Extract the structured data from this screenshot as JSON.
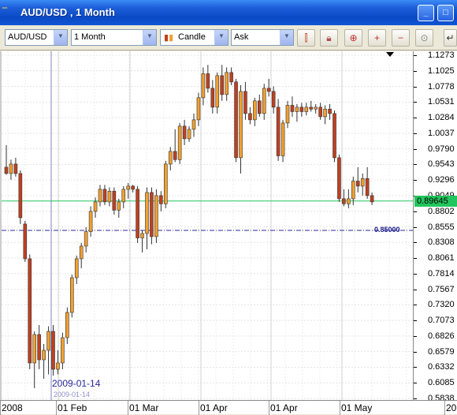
{
  "window": {
    "title": "AUD/USD , 1 Month",
    "accent": "#0a49c6"
  },
  "toolbar": {
    "symbol": "AUD/USD",
    "period": "1 Month",
    "chart_type": "Candle",
    "price_side": "Ask",
    "icons": [
      "bar-chart-icon",
      "lock-icon",
      "zoom-icon",
      "zoom-in-icon",
      "zoom-out-icon",
      "zoom-fit-icon",
      "back-icon"
    ]
  },
  "chart": {
    "price_labels": [
      "1.1273",
      "1.1025",
      "1.0778",
      "1.0531",
      "1.0284",
      "1.0037",
      "0.9790",
      "0.9543",
      "0.9296",
      "0.9049",
      "0.8802",
      "0.8555",
      "0.8308",
      "0.8061",
      "0.7814",
      "0.7567",
      "0.7320",
      "0.7073",
      "0.6826",
      "0.6579",
      "0.6332",
      "0.6085",
      "0.5838"
    ],
    "time_labels": [
      "2008",
      "01 Feb",
      "01 Mar",
      "01 Apr",
      "01 Apr",
      "01 May",
      "20"
    ],
    "current_price": "0.89645",
    "current_price_color": "#22c55e",
    "level_line": "0.85000",
    "level_color": "#1a1a8a",
    "cursor_date": "2009-01-14",
    "cursor_date_small": "2009-01-14",
    "bull_color": "#f0a030",
    "bear_color": "#c04020"
  },
  "chart_data": {
    "type": "candlestick",
    "ylim": [
      0.5838,
      1.1273
    ],
    "candles": [
      {
        "o": 0.95,
        "h": 0.985,
        "l": 0.938,
        "c": 0.94
      },
      {
        "o": 0.94,
        "h": 0.962,
        "l": 0.93,
        "c": 0.955
      },
      {
        "o": 0.955,
        "h": 0.965,
        "l": 0.935,
        "c": 0.94
      },
      {
        "o": 0.94,
        "h": 0.945,
        "l": 0.86,
        "c": 0.87
      },
      {
        "o": 0.86,
        "h": 0.865,
        "l": 0.8,
        "c": 0.805
      },
      {
        "o": 0.805,
        "h": 0.812,
        "l": 0.63,
        "c": 0.64
      },
      {
        "o": 0.64,
        "h": 0.69,
        "l": 0.6,
        "c": 0.685
      },
      {
        "o": 0.685,
        "h": 0.7,
        "l": 0.63,
        "c": 0.645
      },
      {
        "o": 0.645,
        "h": 0.67,
        "l": 0.615,
        "c": 0.66
      },
      {
        "o": 0.66,
        "h": 0.698,
        "l": 0.622,
        "c": 0.69
      },
      {
        "o": 0.69,
        "h": 0.7,
        "l": 0.62,
        "c": 0.63
      },
      {
        "o": 0.63,
        "h": 0.66,
        "l": 0.622,
        "c": 0.64
      },
      {
        "o": 0.64,
        "h": 0.688,
        "l": 0.63,
        "c": 0.68
      },
      {
        "o": 0.68,
        "h": 0.728,
        "l": 0.67,
        "c": 0.72
      },
      {
        "o": 0.72,
        "h": 0.78,
        "l": 0.712,
        "c": 0.775
      },
      {
        "o": 0.775,
        "h": 0.81,
        "l": 0.765,
        "c": 0.805
      },
      {
        "o": 0.805,
        "h": 0.83,
        "l": 0.79,
        "c": 0.825
      },
      {
        "o": 0.825,
        "h": 0.855,
        "l": 0.815,
        "c": 0.848
      },
      {
        "o": 0.848,
        "h": 0.888,
        "l": 0.84,
        "c": 0.88
      },
      {
        "o": 0.88,
        "h": 0.902,
        "l": 0.87,
        "c": 0.895
      },
      {
        "o": 0.895,
        "h": 0.922,
        "l": 0.888,
        "c": 0.915
      },
      {
        "o": 0.915,
        "h": 0.922,
        "l": 0.89,
        "c": 0.895
      },
      {
        "o": 0.895,
        "h": 0.918,
        "l": 0.888,
        "c": 0.912
      },
      {
        "o": 0.912,
        "h": 0.918,
        "l": 0.875,
        "c": 0.882
      },
      {
        "o": 0.882,
        "h": 0.9,
        "l": 0.87,
        "c": 0.895
      },
      {
        "o": 0.895,
        "h": 0.92,
        "l": 0.885,
        "c": 0.915
      },
      {
        "o": 0.915,
        "h": 0.925,
        "l": 0.9,
        "c": 0.92
      },
      {
        "o": 0.92,
        "h": 0.922,
        "l": 0.91,
        "c": 0.915
      },
      {
        "o": 0.915,
        "h": 0.92,
        "l": 0.83,
        "c": 0.838
      },
      {
        "o": 0.838,
        "h": 0.85,
        "l": 0.815,
        "c": 0.845
      },
      {
        "o": 0.845,
        "h": 0.918,
        "l": 0.82,
        "c": 0.91
      },
      {
        "o": 0.91,
        "h": 0.918,
        "l": 0.828,
        "c": 0.84
      },
      {
        "o": 0.84,
        "h": 0.915,
        "l": 0.83,
        "c": 0.905
      },
      {
        "o": 0.905,
        "h": 0.912,
        "l": 0.88,
        "c": 0.892
      },
      {
        "o": 0.892,
        "h": 0.96,
        "l": 0.885,
        "c": 0.955
      },
      {
        "o": 0.955,
        "h": 0.982,
        "l": 0.945,
        "c": 0.975
      },
      {
        "o": 0.975,
        "h": 1.01,
        "l": 0.958,
        "c": 0.962
      },
      {
        "o": 0.962,
        "h": 1.02,
        "l": 0.955,
        "c": 1.015
      },
      {
        "o": 1.015,
        "h": 1.025,
        "l": 0.985,
        "c": 0.995
      },
      {
        "o": 0.995,
        "h": 1.015,
        "l": 0.99,
        "c": 1.01
      },
      {
        "o": 1.01,
        "h": 1.035,
        "l": 0.998,
        "c": 1.025
      },
      {
        "o": 1.025,
        "h": 1.068,
        "l": 1.015,
        "c": 1.06
      },
      {
        "o": 1.06,
        "h": 1.108,
        "l": 1.048,
        "c": 1.098
      },
      {
        "o": 1.098,
        "h": 1.112,
        "l": 1.068,
        "c": 1.075
      },
      {
        "o": 1.075,
        "h": 1.088,
        "l": 1.035,
        "c": 1.045
      },
      {
        "o": 1.045,
        "h": 1.1,
        "l": 1.035,
        "c": 1.095
      },
      {
        "o": 1.095,
        "h": 1.112,
        "l": 1.055,
        "c": 1.065
      },
      {
        "o": 1.065,
        "h": 1.108,
        "l": 1.055,
        "c": 1.1
      },
      {
        "o": 1.1,
        "h": 1.108,
        "l": 1.08,
        "c": 1.085
      },
      {
        "o": 1.085,
        "h": 1.09,
        "l": 0.958,
        "c": 0.965
      },
      {
        "o": 0.965,
        "h": 1.08,
        "l": 0.94,
        "c": 1.07
      },
      {
        "o": 1.07,
        "h": 1.085,
        "l": 1.025,
        "c": 1.035
      },
      {
        "o": 1.035,
        "h": 1.045,
        "l": 1.018,
        "c": 1.025
      },
      {
        "o": 1.025,
        "h": 1.06,
        "l": 1.015,
        "c": 1.055
      },
      {
        "o": 1.055,
        "h": 1.065,
        "l": 1.03,
        "c": 1.035
      },
      {
        "o": 1.035,
        "h": 1.082,
        "l": 1.025,
        "c": 1.075
      },
      {
        "o": 1.075,
        "h": 1.09,
        "l": 1.062,
        "c": 1.07
      },
      {
        "o": 1.07,
        "h": 1.078,
        "l": 1.035,
        "c": 1.045
      },
      {
        "o": 1.045,
        "h": 1.058,
        "l": 0.96,
        "c": 0.968
      },
      {
        "o": 0.968,
        "h": 1.025,
        "l": 0.958,
        "c": 1.02
      },
      {
        "o": 1.02,
        "h": 1.055,
        "l": 1.012,
        "c": 1.048
      },
      {
        "o": 1.048,
        "h": 1.062,
        "l": 1.03,
        "c": 1.038
      },
      {
        "o": 1.038,
        "h": 1.05,
        "l": 1.022,
        "c": 1.045
      },
      {
        "o": 1.045,
        "h": 1.052,
        "l": 1.03,
        "c": 1.038
      },
      {
        "o": 1.038,
        "h": 1.052,
        "l": 1.032,
        "c": 1.045
      },
      {
        "o": 1.045,
        "h": 1.055,
        "l": 1.038,
        "c": 1.042
      },
      {
        "o": 1.042,
        "h": 1.05,
        "l": 1.035,
        "c": 1.045
      },
      {
        "o": 1.045,
        "h": 1.052,
        "l": 1.025,
        "c": 1.03
      },
      {
        "o": 1.03,
        "h": 1.048,
        "l": 1.018,
        "c": 1.042
      },
      {
        "o": 1.042,
        "h": 1.05,
        "l": 1.025,
        "c": 1.035
      },
      {
        "o": 1.035,
        "h": 1.04,
        "l": 0.958,
        "c": 0.965
      },
      {
        "o": 0.965,
        "h": 0.97,
        "l": 0.895,
        "c": 0.9
      },
      {
        "o": 0.9,
        "h": 0.915,
        "l": 0.888,
        "c": 0.892
      },
      {
        "o": 0.892,
        "h": 0.915,
        "l": 0.885,
        "c": 0.9
      },
      {
        "o": 0.9,
        "h": 0.935,
        "l": 0.89,
        "c": 0.928
      },
      {
        "o": 0.928,
        "h": 0.95,
        "l": 0.91,
        "c": 0.92
      },
      {
        "o": 0.92,
        "h": 0.94,
        "l": 0.905,
        "c": 0.932
      },
      {
        "o": 0.932,
        "h": 0.95,
        "l": 0.9,
        "c": 0.905
      },
      {
        "o": 0.905,
        "h": 0.91,
        "l": 0.89,
        "c": 0.895
      }
    ]
  }
}
